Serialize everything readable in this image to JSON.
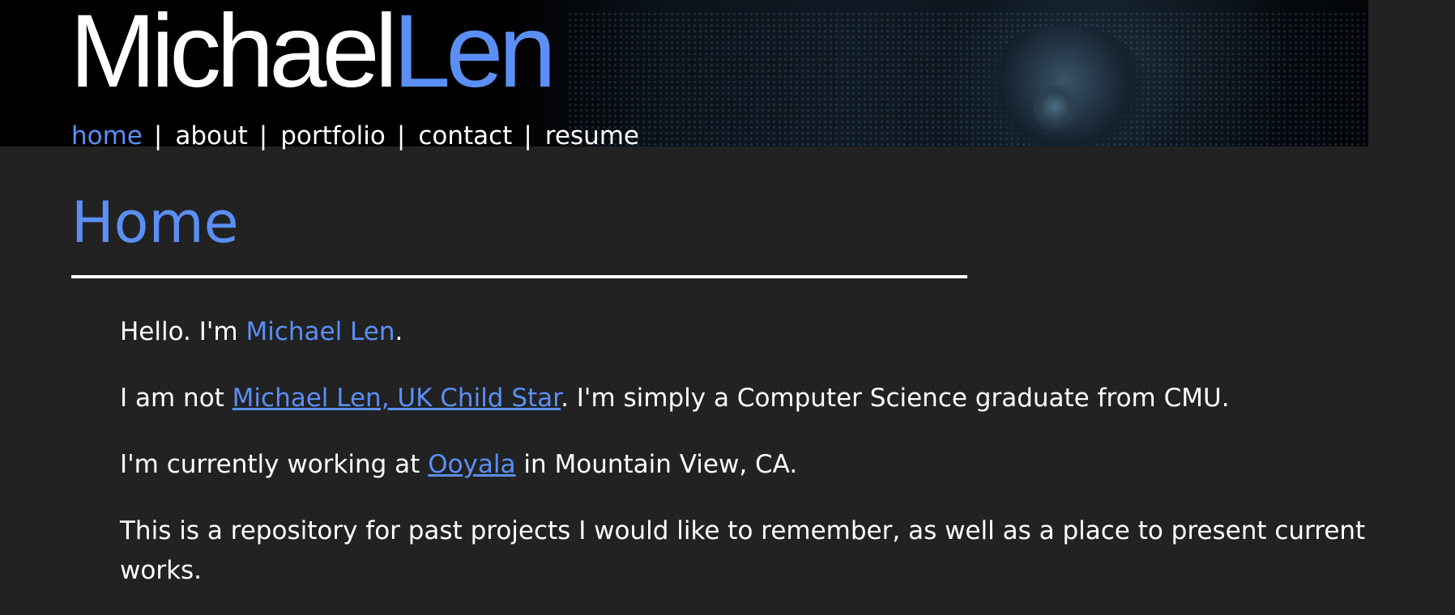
{
  "logo": {
    "first": "Michael",
    "last": "Len"
  },
  "nav": {
    "items": [
      {
        "label": "home",
        "active": true
      },
      {
        "label": "about",
        "active": false
      },
      {
        "label": "portfolio",
        "active": false
      },
      {
        "label": "contact",
        "active": false
      },
      {
        "label": "resume",
        "active": false
      }
    ],
    "separator": "|"
  },
  "main": {
    "title": "Home",
    "paragraphs": {
      "p1": {
        "pre": "Hello. I'm ",
        "name": "Michael Len",
        "post": "."
      },
      "p2": {
        "pre": "I am not ",
        "link": "Michael Len, UK Child Star",
        "post": ". I'm simply a Computer Science graduate from CMU."
      },
      "p3": {
        "pre": "I'm currently working at ",
        "link": "Ooyala",
        "post": " in Mountain View, CA."
      },
      "p4": {
        "text": "This is a repository for past projects I would like to remember, as well as a place to present current works."
      }
    }
  },
  "colors": {
    "accent": "#5b8ff5",
    "background": "#222222",
    "text": "#ffffff",
    "banner": "#000000"
  }
}
